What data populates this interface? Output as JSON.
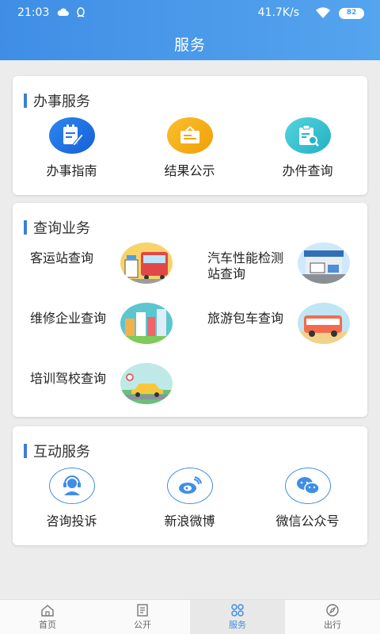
{
  "status": {
    "time": "21:03",
    "speed": "41.7K/s",
    "battery": "82"
  },
  "header": {
    "title": "服务"
  },
  "sections": [
    {
      "title": "办事服务",
      "items": [
        {
          "label": "办事指南",
          "icon": "document-edit-icon"
        },
        {
          "label": "结果公示",
          "icon": "notice-board-icon"
        },
        {
          "label": "办件查询",
          "icon": "clipboard-search-icon"
        }
      ]
    },
    {
      "title": "查询业务",
      "items": [
        {
          "label": "客运站查询",
          "icon": "bus-station-image"
        },
        {
          "label": "汽车性能检测站查询",
          "icon": "inspection-station-image"
        },
        {
          "label": "维修企业查询",
          "icon": "city-buildings-image"
        },
        {
          "label": "旅游包车查询",
          "icon": "tour-bus-image"
        },
        {
          "label": "培训驾校查询",
          "icon": "driving-school-image"
        }
      ]
    },
    {
      "title": "互动服务",
      "items": [
        {
          "label": "咨询投诉",
          "icon": "customer-service-icon"
        },
        {
          "label": "新浪微博",
          "icon": "weibo-icon"
        },
        {
          "label": "微信公众号",
          "icon": "wechat-icon"
        }
      ]
    }
  ],
  "tabs": [
    {
      "label": "首页",
      "icon": "home-icon",
      "active": false
    },
    {
      "label": "公开",
      "icon": "document-icon",
      "active": false
    },
    {
      "label": "服务",
      "icon": "grid-icon",
      "active": true
    },
    {
      "label": "出行",
      "icon": "compass-icon",
      "active": false
    }
  ],
  "colors": {
    "header": "#4d9be9",
    "accent": "#3f7fd3",
    "background": "#ececec"
  }
}
